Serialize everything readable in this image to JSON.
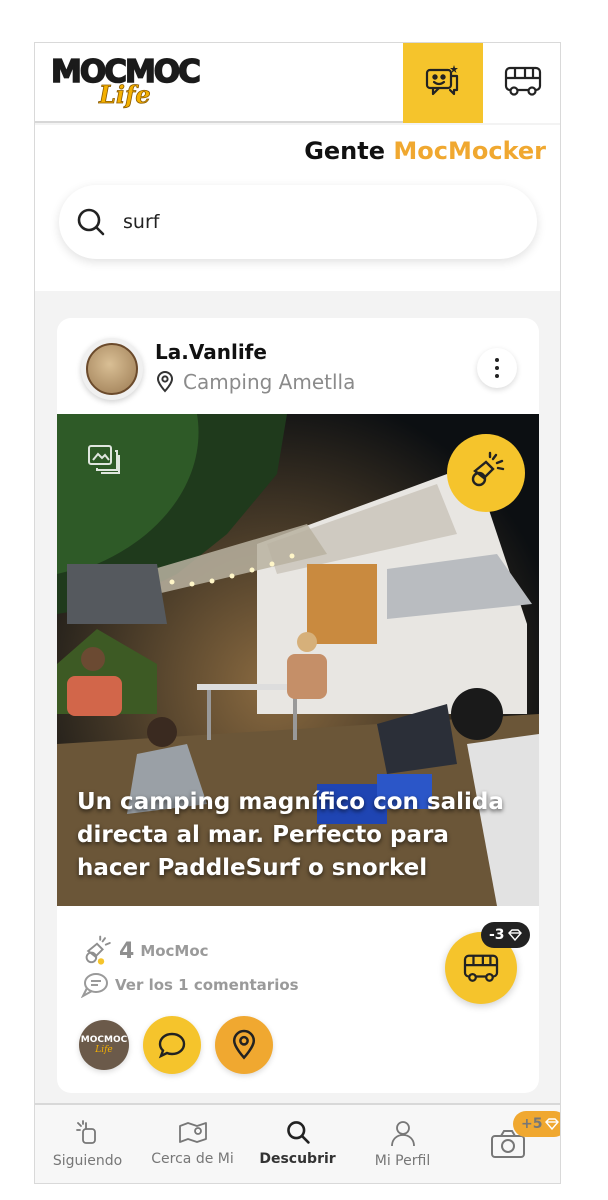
{
  "header": {
    "logo_main": "MOCMOC",
    "logo_sub": "Life"
  },
  "page": {
    "title_part1": "Gente",
    "title_part2": "MocMocker"
  },
  "search": {
    "value": "surf"
  },
  "post": {
    "user_name": "La.Vanlife",
    "location": "Camping Ametlla",
    "caption": "Un camping magnífico con salida directa al mar. Perfecto para hacer PaddleSurf o snorkel",
    "mocmoc_count": "4",
    "mocmoc_label": "MocMoc",
    "comments_label": "Ver los 1 comentarios",
    "van_badge": "-3",
    "logo_l1": "MOCMOC",
    "logo_l2": "Life"
  },
  "nav": {
    "items": [
      {
        "label": "Siguiendo"
      },
      {
        "label": "Cerca de Mi"
      },
      {
        "label": "Descubrir"
      },
      {
        "label": "Mi Perfil"
      }
    ],
    "camera_badge": "+5"
  },
  "colors": {
    "accent_yellow": "#f5c42c",
    "accent_orange": "#f0a830"
  }
}
